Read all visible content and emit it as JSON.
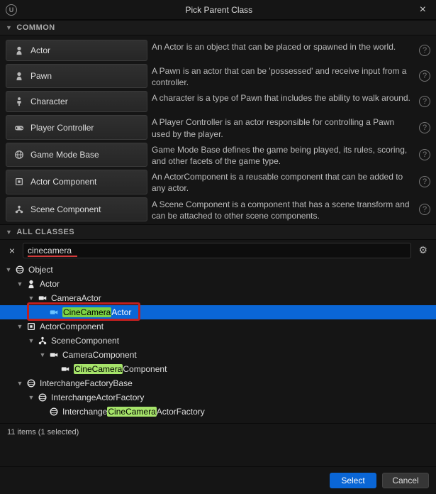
{
  "title": "Pick Parent Class",
  "sections": {
    "common": "COMMON",
    "all_classes": "ALL CLASSES"
  },
  "common": [
    {
      "id": "actor",
      "label": "Actor",
      "desc": "An Actor is an object that can be placed or spawned in the world."
    },
    {
      "id": "pawn",
      "label": "Pawn",
      "desc": "A Pawn is an actor that can be 'possessed' and receive input from a controller."
    },
    {
      "id": "character",
      "label": "Character",
      "desc": "A character is a type of Pawn that includes the ability to walk around."
    },
    {
      "id": "player-controller",
      "label": "Player Controller",
      "desc": "A Player Controller is an actor responsible for controlling a Pawn used by the player."
    },
    {
      "id": "game-mode-base",
      "label": "Game Mode Base",
      "desc": "Game Mode Base defines the game being played, its rules, scoring, and other facets of the game type."
    },
    {
      "id": "actor-component",
      "label": "Actor Component",
      "desc": "An ActorComponent is a reusable component that can be added to any actor."
    },
    {
      "id": "scene-component",
      "label": "Scene Component",
      "desc": "A Scene Component is a component that has a scene transform and can be attached to other scene components."
    }
  ],
  "search": {
    "value": "cinecamera"
  },
  "tree": [
    {
      "depth": 0,
      "exp": "down",
      "icon": "sphere",
      "pre": "",
      "match": "",
      "post": "Object"
    },
    {
      "depth": 1,
      "exp": "down",
      "icon": "pawn",
      "pre": "",
      "match": "",
      "post": "Actor"
    },
    {
      "depth": 2,
      "exp": "down",
      "icon": "cam",
      "pre": "",
      "match": "",
      "post": "CameraActor"
    },
    {
      "depth": 3,
      "exp": "none",
      "icon": "cam-blue",
      "selected": true,
      "boxed": true,
      "pre": "",
      "match": "CineCamera",
      "post": "Actor"
    },
    {
      "depth": 1,
      "exp": "down",
      "icon": "comp",
      "pre": "",
      "match": "",
      "post": "ActorComponent"
    },
    {
      "depth": 2,
      "exp": "down",
      "icon": "scene",
      "pre": "",
      "match": "",
      "post": "SceneComponent"
    },
    {
      "depth": 3,
      "exp": "down",
      "icon": "cam",
      "pre": "",
      "match": "",
      "post": "CameraComponent"
    },
    {
      "depth": 4,
      "exp": "none",
      "icon": "cam",
      "pre": "",
      "match": "CineCamera",
      "post": "Component"
    },
    {
      "depth": 1,
      "exp": "down",
      "icon": "sphere",
      "pre": "",
      "match": "",
      "post": "InterchangeFactoryBase"
    },
    {
      "depth": 2,
      "exp": "down",
      "icon": "sphere",
      "pre": "",
      "match": "",
      "post": "InterchangeActorFactory"
    },
    {
      "depth": 3,
      "exp": "none",
      "icon": "sphere",
      "pre": "Interchange",
      "match": "CineCamera",
      "post": "ActorFactory"
    }
  ],
  "status": "11 items (1 selected)",
  "footer": {
    "select": "Select",
    "cancel": "Cancel"
  }
}
